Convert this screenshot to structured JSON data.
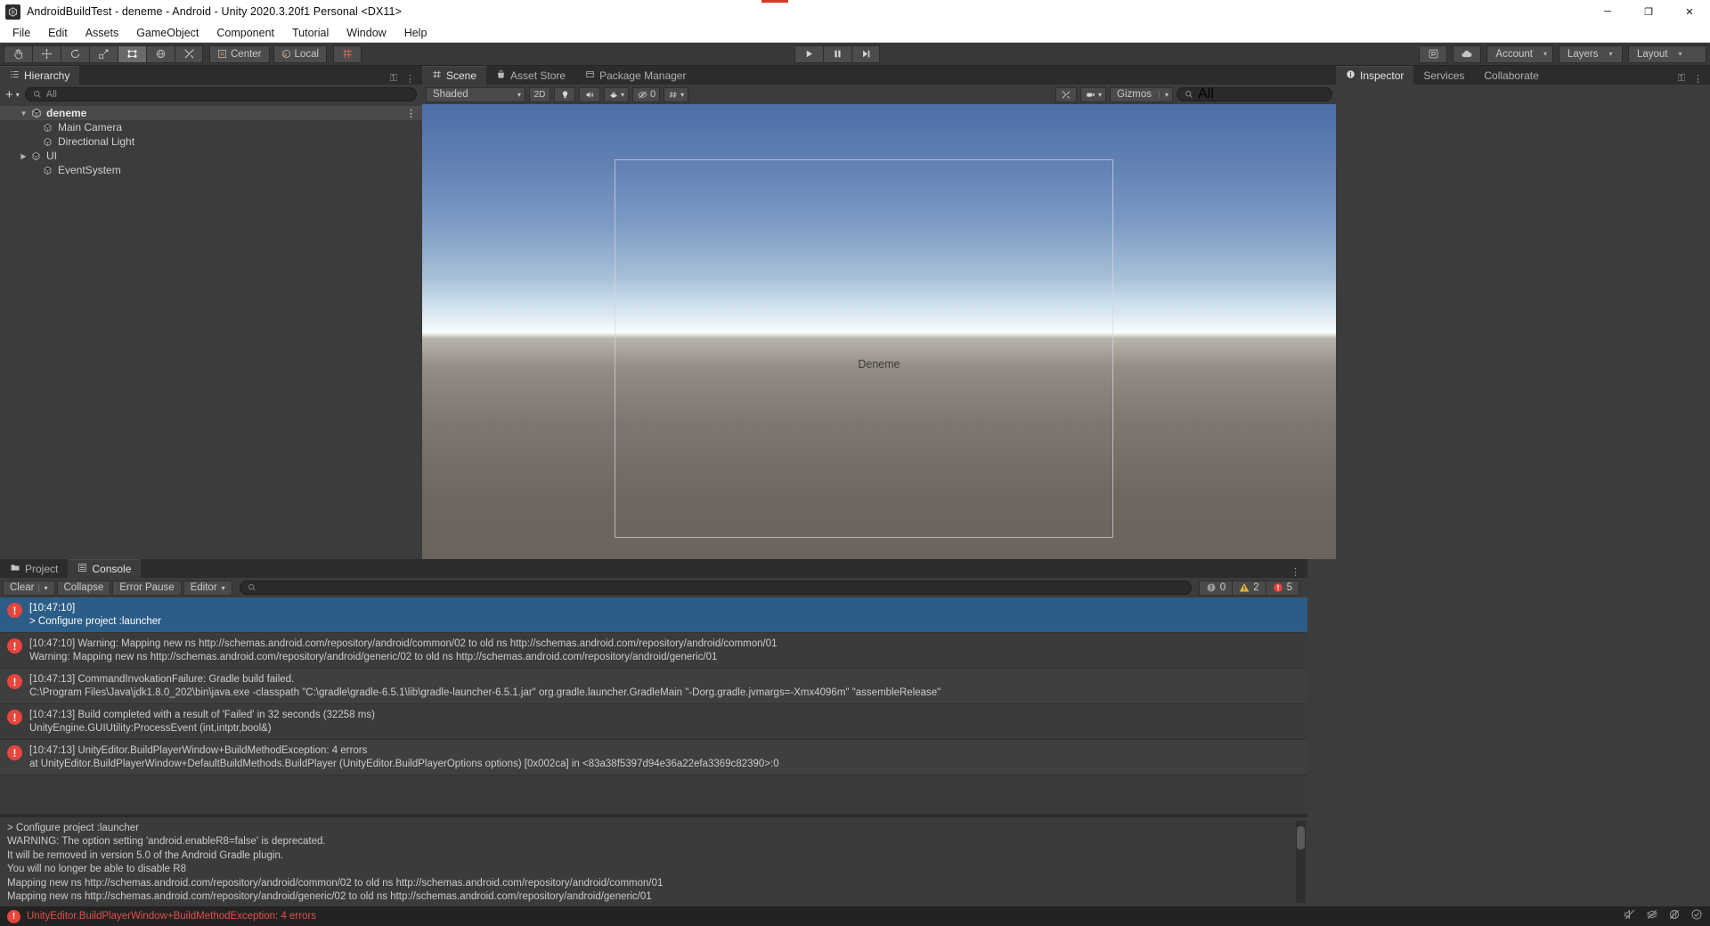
{
  "window": {
    "title": "AndroidBuildTest - deneme - Android - Unity 2020.3.20f1 Personal <DX11>",
    "icon": "unity-icon",
    "minimize": "─",
    "maximize": "❐",
    "close": "✕"
  },
  "menubar": {
    "items": [
      "File",
      "Edit",
      "Assets",
      "GameObject",
      "Component",
      "Tutorial",
      "Window",
      "Help"
    ]
  },
  "toolbar": {
    "tools": [
      {
        "name": "hand-tool",
        "glyph": "✋"
      },
      {
        "name": "move-tool",
        "glyph": "✥"
      },
      {
        "name": "rotate-tool",
        "glyph": "↻"
      },
      {
        "name": "scale-tool",
        "glyph": "⤡"
      },
      {
        "name": "rect-transform-tool",
        "glyph": "▣"
      },
      {
        "name": "transform-tool",
        "glyph": "⬡"
      },
      {
        "name": "custom-tool",
        "glyph": "⚒"
      }
    ],
    "pivot_label": "Center",
    "rotation_label": "Local",
    "grid_label": "grid-snap",
    "play": "▶",
    "pause": "❙❙",
    "step": "▶❙",
    "collab_label": "collab-icon",
    "cloud_label": "cloud-icon",
    "account_label": "Account",
    "layers_label": "Layers",
    "layout_label": "Layout",
    "caret": "▾"
  },
  "hierarchy": {
    "tab_label": "Hierarchy",
    "tab_icon": "hierarchy-icon",
    "lock_icon": "⚿",
    "menu_icon": "⋮",
    "add_label": "+",
    "search_placeholder": "All",
    "items": [
      {
        "label": "deneme",
        "depth": 0,
        "arrow": "▼",
        "type": "scene",
        "selected": true
      },
      {
        "label": "Main Camera",
        "depth": 1,
        "arrow": "",
        "type": "gameobject",
        "selected": false
      },
      {
        "label": "Directional Light",
        "depth": 1,
        "arrow": "",
        "type": "gameobject",
        "selected": false
      },
      {
        "label": "UI",
        "depth": 1,
        "arrow": "▶",
        "type": "gameobject",
        "selected": false
      },
      {
        "label": "EventSystem",
        "depth": 1,
        "arrow": "",
        "type": "gameobject",
        "selected": false
      }
    ]
  },
  "scene": {
    "tabs": [
      {
        "label": "Scene",
        "icon": "grid-icon",
        "active": true
      },
      {
        "label": "Asset Store",
        "icon": "store-icon",
        "active": false
      },
      {
        "label": "Package Manager",
        "icon": "package-icon",
        "active": false
      }
    ],
    "lock_icon": "⚿",
    "menu_icon": "⋮",
    "draw_mode": "Shaded",
    "mode_2d": "2D",
    "lighting_icon": "●",
    "audio_icon": "◂))",
    "effects_icon": "☁",
    "hidden_count": "0",
    "hidden_icon": "eye-off-icon",
    "grid_icon": "grid-visibility-icon",
    "tools_icon": "⚒",
    "camera_icon": "■",
    "gizmos_label": "Gizmos",
    "search_placeholder": "All",
    "caret": "▾",
    "canvas_label": "Deneme"
  },
  "inspector": {
    "tabs": [
      {
        "label": "Inspector",
        "icon": "info-icon",
        "active": true
      },
      {
        "label": "Services",
        "icon": "",
        "active": false
      },
      {
        "label": "Collaborate",
        "icon": "",
        "active": false
      }
    ],
    "lock_icon": "⚿",
    "menu_icon": "⋮"
  },
  "console": {
    "tabs": [
      {
        "label": "Project",
        "icon": "folder-icon",
        "active": false
      },
      {
        "label": "Console",
        "icon": "console-icon",
        "active": true
      }
    ],
    "menu_icon": "⋮",
    "clear_label": "Clear",
    "clear_caret": "▾",
    "collapse_label": "Collapse",
    "error_pause_label": "Error Pause",
    "editor_label": "Editor",
    "editor_caret": "▾",
    "search_placeholder": "",
    "counts": {
      "info": "0",
      "warning": "2",
      "error": "5"
    },
    "entries": [
      {
        "type": "error",
        "selected": true,
        "lines": [
          "[10:47:10]",
          "> Configure project :launcher"
        ]
      },
      {
        "type": "error",
        "selected": false,
        "lines": [
          "[10:47:10] Warning: Mapping new ns http://schemas.android.com/repository/android/common/02 to old ns http://schemas.android.com/repository/android/common/01",
          "Warning: Mapping new ns http://schemas.android.com/repository/android/generic/02 to old ns http://schemas.android.com/repository/android/generic/01"
        ]
      },
      {
        "type": "error",
        "selected": false,
        "lines": [
          "[10:47:13] CommandInvokationFailure: Gradle build failed.",
          "C:\\Program Files\\Java\\jdk1.8.0_202\\bin\\java.exe -classpath \"C:\\gradle\\gradle-6.5.1\\lib\\gradle-launcher-6.5.1.jar\" org.gradle.launcher.GradleMain \"-Dorg.gradle.jvmargs=-Xmx4096m\" \"assembleRelease\""
        ]
      },
      {
        "type": "error",
        "selected": false,
        "lines": [
          "[10:47:13] Build completed with a result of 'Failed' in 32 seconds (32258 ms)",
          "UnityEngine.GUIUtility:ProcessEvent (int,intptr,bool&)"
        ]
      },
      {
        "type": "error",
        "selected": false,
        "lines": [
          "[10:47:13] UnityEditor.BuildPlayerWindow+BuildMethodException: 4 errors",
          "  at UnityEditor.BuildPlayerWindow+DefaultBuildMethods.BuildPlayer (UnityEditor.BuildPlayerOptions options) [0x002ca] in <83a38f5397d94e36a22efa3369c82390>:0"
        ]
      }
    ],
    "detail_lines": [
      "> Configure project :launcher",
      "WARNING: The option setting 'android.enableR8=false' is deprecated.",
      "It will be removed in version 5.0 of the Android Gradle plugin.",
      "You will no longer be able to disable R8",
      "Mapping new ns http://schemas.android.com/repository/android/common/02 to old ns http://schemas.android.com/repository/android/common/01",
      "Mapping new ns http://schemas.android.com/repository/android/generic/02 to old ns http://schemas.android.com/repository/android/generic/01"
    ]
  },
  "statusbar": {
    "message": "UnityEditor.BuildPlayerWindow+BuildMethodException: 4 errors",
    "icons": [
      "mute-audio-icon",
      "layers-off-icon",
      "preview-off-icon",
      "check-circle-icon"
    ]
  },
  "colors": {
    "error": "#e8453c",
    "warning": "#e5b93c",
    "selection": "#2c5d87",
    "panel": "#3c3c3c",
    "chrome": "#383838"
  }
}
